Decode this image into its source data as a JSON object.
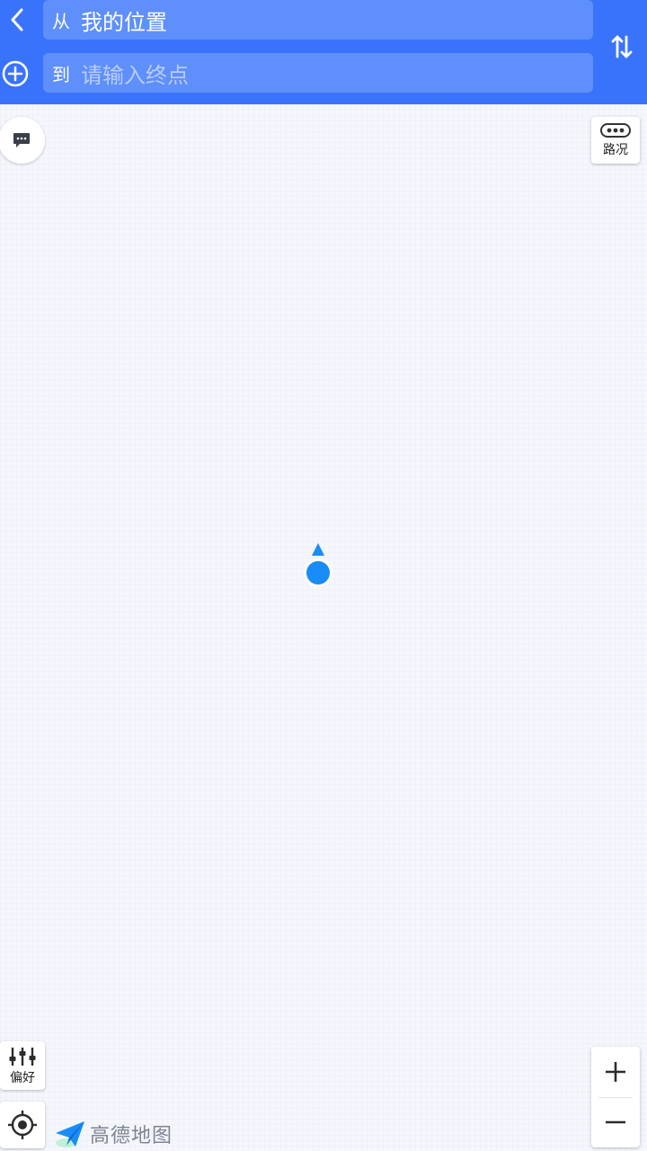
{
  "header": {
    "from_prefix": "从",
    "from_value": "我的位置",
    "to_prefix": "到",
    "to_placeholder": "请输入终点"
  },
  "map": {
    "traffic_label": "路况",
    "preference_label": "偏好",
    "brand_text": "高德地图"
  },
  "icons": {
    "back": "chevron-left-icon",
    "add": "plus-circle-icon",
    "swap": "swap-vertical-icon",
    "message": "chat-bubble-icon",
    "traffic": "traffic-light-icon",
    "preference": "sliders-icon",
    "locate": "crosshair-icon",
    "zoom_in": "plus-icon",
    "zoom_out": "minus-icon",
    "marker": "current-location-marker"
  },
  "colors": {
    "header_bg": "#3a73fb",
    "field_bg": "#5f8ffb",
    "marker": "#1a8cf7",
    "map_bg": "#f5f7fc"
  }
}
